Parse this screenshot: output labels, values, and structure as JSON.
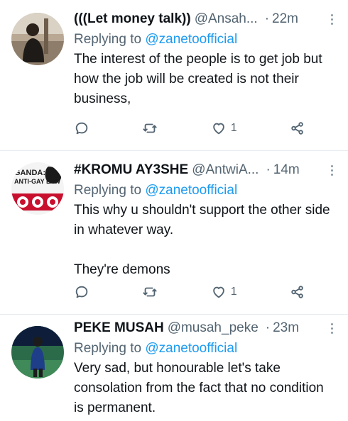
{
  "tweets": [
    {
      "name": "(((Let money talk))",
      "handle": "@Ansah...",
      "time": "22m",
      "replying_prefix": "Replying to ",
      "replying_to": "@zanetoofficial",
      "text": "The interest of the people is to get job but how the job will be created is not their business,",
      "likes": "1"
    },
    {
      "name": "#KROMU AY3SHE",
      "handle": "@AntwiA...",
      "time": "14m",
      "replying_prefix": "Replying to ",
      "replying_to": "@zanetoofficial",
      "text": "This why u shouldn't support the other side in whatever way.\n\nThey're demons",
      "likes": "1",
      "avatar_text_top": "GANDA:",
      "avatar_text_mid": "ANTI-GAY LAW"
    },
    {
      "name": "PEKE MUSAH",
      "handle": "@musah_peke",
      "time": "23m",
      "replying_prefix": "Replying to ",
      "replying_to": "@zanetoofficial",
      "text": "Very sad, but honourable let's take consolation from the fact that no condition is permanent."
    }
  ],
  "colors": {
    "link": "#1d9bf0",
    "secondary": "#536471",
    "divider": "#e6ecf0"
  },
  "icons": [
    "reply-icon",
    "retweet-icon",
    "like-icon",
    "share-icon",
    "more-icon"
  ]
}
